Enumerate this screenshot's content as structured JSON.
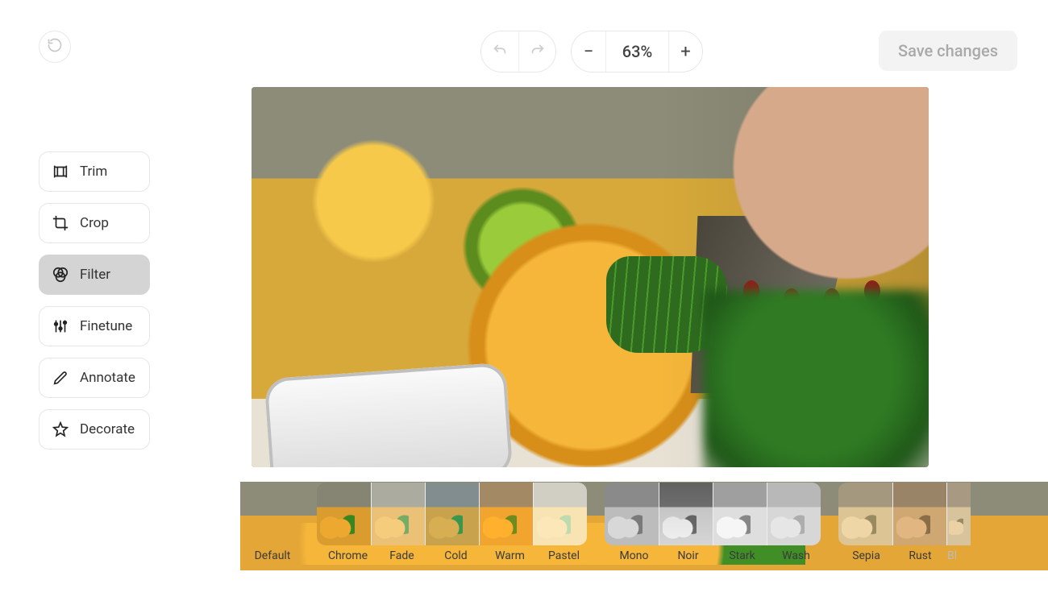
{
  "toolbar": {
    "zoom_level": "63%",
    "save_label": "Save changes"
  },
  "tools": [
    {
      "id": "trim",
      "label": "Trim",
      "active": false
    },
    {
      "id": "crop",
      "label": "Crop",
      "active": false
    },
    {
      "id": "filter",
      "label": "Filter",
      "active": true
    },
    {
      "id": "finetune",
      "label": "Finetune",
      "active": false
    },
    {
      "id": "annotate",
      "label": "Annotate",
      "active": false
    },
    {
      "id": "decorate",
      "label": "Decorate",
      "active": false
    }
  ],
  "filters": {
    "selected": "Default",
    "groups": [
      {
        "single": true,
        "items": [
          {
            "label": "Default"
          }
        ]
      },
      {
        "single": false,
        "items": [
          {
            "label": "Chrome"
          },
          {
            "label": "Fade"
          },
          {
            "label": "Cold"
          },
          {
            "label": "Warm"
          },
          {
            "label": "Pastel"
          }
        ]
      },
      {
        "single": false,
        "items": [
          {
            "label": "Mono"
          },
          {
            "label": "Noir"
          },
          {
            "label": "Stark"
          },
          {
            "label": "Wash"
          }
        ]
      },
      {
        "single": false,
        "cut": true,
        "items": [
          {
            "label": "Sepia"
          },
          {
            "label": "Rust"
          },
          {
            "label": "Bl"
          }
        ]
      }
    ]
  }
}
